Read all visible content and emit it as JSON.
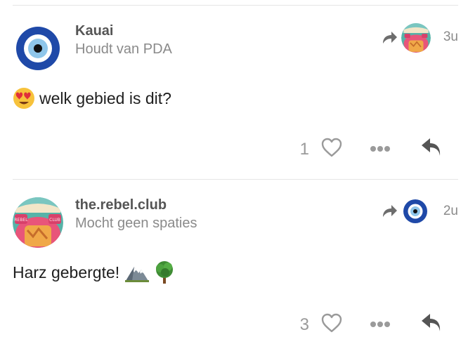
{
  "posts": [
    {
      "username": "Kauai",
      "user_title": "Houdt van PDA",
      "date": "3u",
      "content_text": "welk gebied is dit?",
      "like_count": "1",
      "avatar_icon": "nazar-eye-avatar",
      "reply_to_avatar_icon": "rebel-club-avatar",
      "emojis": [
        "heart-eyes-emoji"
      ]
    },
    {
      "username": "the.rebel.club",
      "user_title": "Mocht geen spaties",
      "date": "2u",
      "content_text": "Harz gebergte!",
      "like_count": "3",
      "avatar_icon": "rebel-club-avatar",
      "avatar_label_left": "REBEL",
      "avatar_label_right": "CLUB",
      "reply_to_avatar_icon": "nazar-eye-avatar",
      "emojis": [
        "mountain-emoji",
        "deciduous-tree-emoji"
      ]
    }
  ],
  "colors": {
    "nazar_blue": "#1f49a8",
    "rebel_pink": "#e8557a",
    "icon_gray": "#6d6d6d"
  }
}
